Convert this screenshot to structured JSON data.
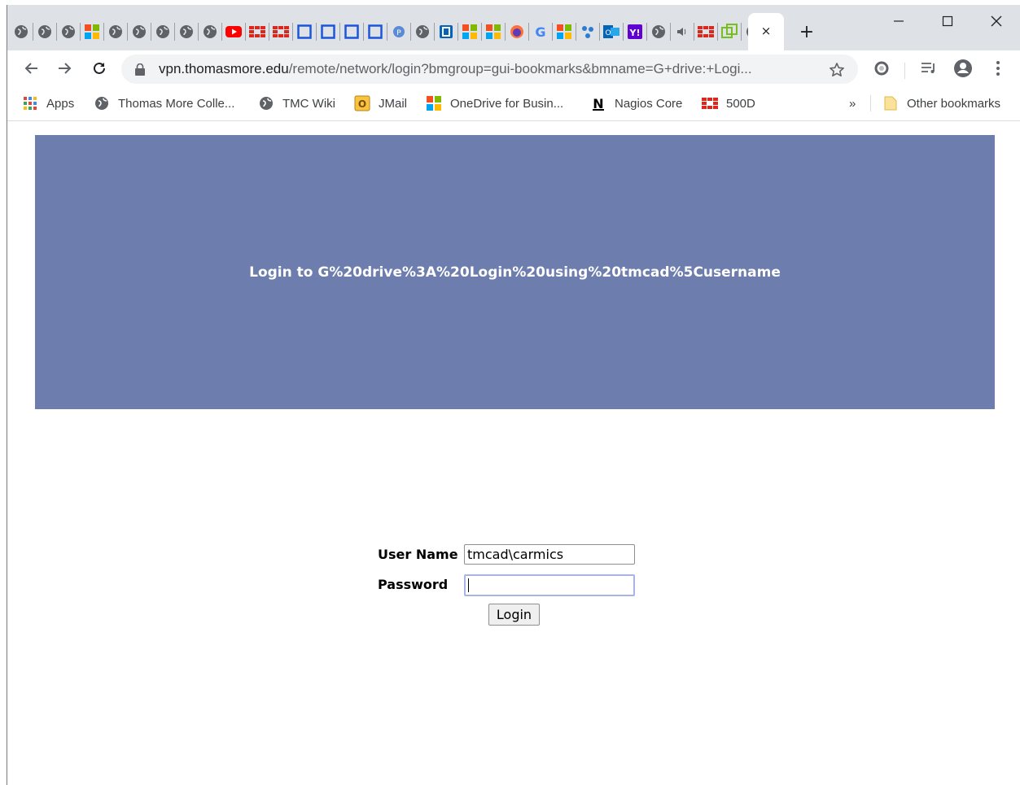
{
  "tabs": {
    "icons": [
      "globe-icon",
      "globe-icon",
      "globe-icon",
      "microsoft-icon",
      "globe-icon",
      "globe-icon",
      "globe-icon",
      "globe-icon",
      "globe-icon",
      "youtube-icon",
      "fortinet-icon",
      "fortinet-icon",
      "square-icon",
      "square-icon",
      "square-icon",
      "square-icon",
      "proxy-icon",
      "globe-icon",
      "onedrive-icon",
      "microsoft-icon",
      "microsoft-icon",
      "firefox-icon",
      "google-icon",
      "microsoft-icon",
      "diagram-icon",
      "outlook-icon",
      "yahoo-icon",
      "globe-icon",
      "speaker-icon",
      "fortinet-icon",
      "vmware-icon",
      "globe-icon"
    ],
    "active_close": "×",
    "new_tab": "+"
  },
  "window": {
    "minimize": "–",
    "maximize": "□",
    "close": "✕"
  },
  "toolbar": {
    "url_host": "vpn.thomasmore.edu",
    "url_path": "/remote/network/login?bmgroup=gui-bookmarks&bmname=G+drive:+Logi..."
  },
  "bookmarks": {
    "items": [
      {
        "label": "Apps",
        "icon": "apps-grid-icon"
      },
      {
        "label": "Thomas More Colle...",
        "icon": "globe-icon"
      },
      {
        "label": "TMC Wiki",
        "icon": "globe-icon"
      },
      {
        "label": "JMail",
        "icon": "mail-icon"
      },
      {
        "label": "OneDrive for Busin...",
        "icon": "microsoft-icon"
      },
      {
        "label": "Nagios Core",
        "icon": "nagios-icon"
      },
      {
        "label": "500D",
        "icon": "fortinet-icon"
      }
    ],
    "overflow": "»",
    "other": "Other bookmarks"
  },
  "page": {
    "banner_title": "Login to G%20drive%3A%20Login%20using%20tmcad%5Cusername",
    "username_label": "User Name",
    "username_value": "tmcad\\carmics",
    "password_label": "Password",
    "login_button": "Login"
  },
  "colors": {
    "banner": "#6d7dae",
    "tabstrip": "#dee1e6",
    "omnibox": "#f1f3f4"
  }
}
